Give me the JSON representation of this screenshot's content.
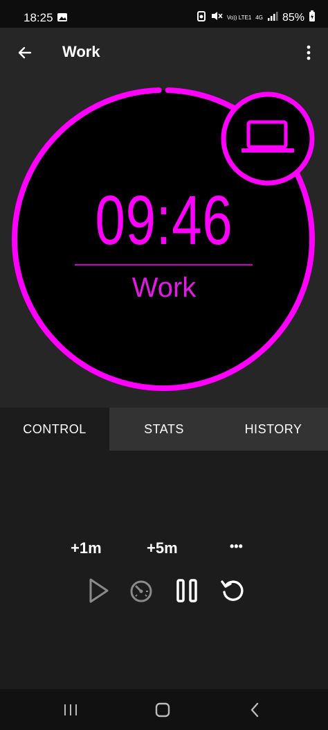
{
  "status": {
    "time": "18:25",
    "battery": "85%",
    "network": "Vo)) LTE1",
    "network_type": "4G"
  },
  "appbar": {
    "title": "Work"
  },
  "timer": {
    "time": "09:46",
    "label": "Work",
    "progress": 0.99,
    "accent": "#ff00ff",
    "icon": "laptop-icon"
  },
  "tabs": [
    {
      "label": "CONTROL",
      "active": true
    },
    {
      "label": "STATS",
      "active": false
    },
    {
      "label": "HISTORY",
      "active": false
    }
  ],
  "controls": {
    "add_1m": "+1m",
    "add_5m": "+5m",
    "more": "•••"
  }
}
